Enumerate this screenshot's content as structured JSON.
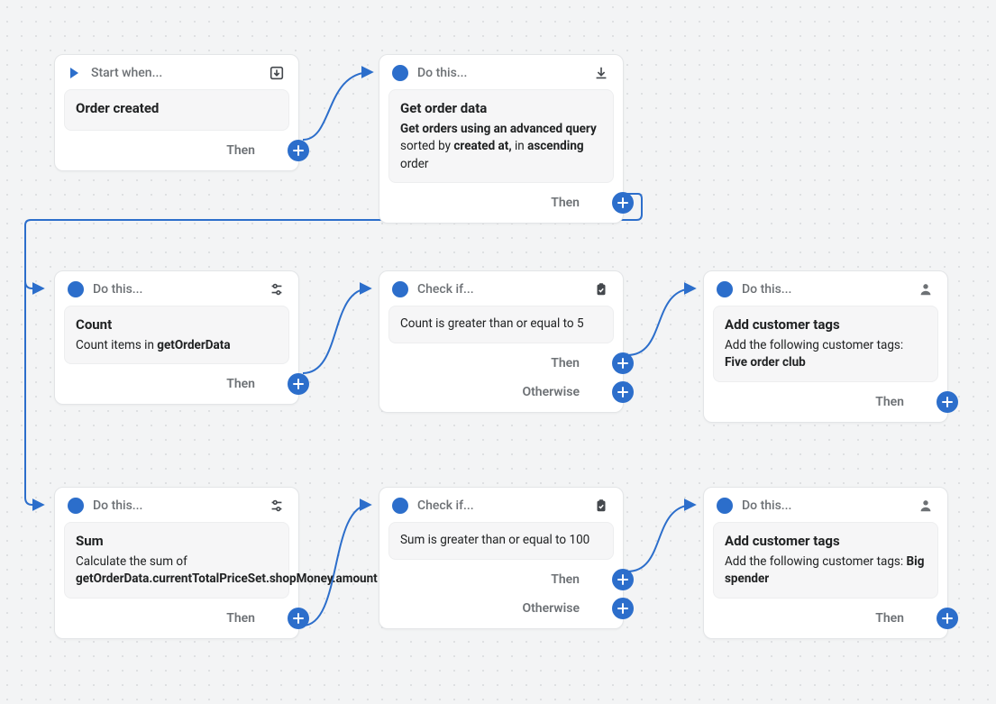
{
  "nodes": {
    "n1": {
      "header": "Start when...",
      "title": "Order created",
      "desc_html": "",
      "footer": [
        "Then"
      ]
    },
    "n2": {
      "header": "Do this...",
      "title": "Get order data",
      "desc_html": "<b>Get orders using an advanced query</b> sorted by <b>created at,</b> in <b>ascending</b> order",
      "footer": [
        "Then"
      ]
    },
    "n3": {
      "header": "Do this...",
      "title": "Count",
      "desc_html": "Count items in <b>getOrderData</b>",
      "footer": [
        "Then"
      ]
    },
    "n4": {
      "header": "Check if...",
      "title": "",
      "desc_html": "Count is greater than or equal to 5",
      "footer": [
        "Then",
        "Otherwise"
      ]
    },
    "n5": {
      "header": "Do this...",
      "title": "Add customer tags",
      "desc_html": "Add the following customer tags: <b>Five order club</b>",
      "footer": [
        "Then"
      ]
    },
    "n6": {
      "header": "Do this...",
      "title": "Sum",
      "desc_html": "Calculate the sum of <b>getOrderData.currentTotalPriceSet.shopMoney.amount</b>",
      "footer": [
        "Then"
      ]
    },
    "n7": {
      "header": "Check if...",
      "title": "",
      "desc_html": "Sum is greater than or equal to 100",
      "footer": [
        "Then",
        "Otherwise"
      ]
    },
    "n8": {
      "header": "Do this...",
      "title": "Add customer tags",
      "desc_html": "Add the following customer tags: <b>Big spender</b>",
      "footer": [
        "Then"
      ]
    }
  }
}
